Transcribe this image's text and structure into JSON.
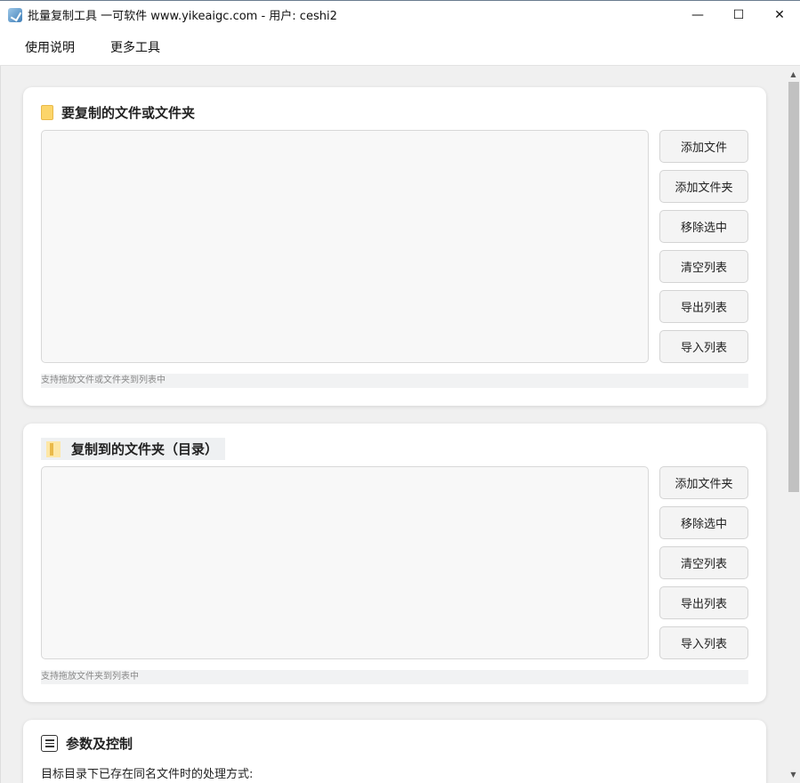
{
  "window": {
    "title": "批量复制工具 一可软件 www.yikeaigc.com - 用户: ceshi2",
    "controls": {
      "minimize": "—",
      "maximize": "☐",
      "close": "✕"
    }
  },
  "menu": {
    "items": [
      "使用说明",
      "更多工具"
    ]
  },
  "source_panel": {
    "title": "要复制的文件或文件夹",
    "buttons": [
      "添加文件",
      "添加文件夹",
      "移除选中",
      "清空列表",
      "导出列表",
      "导入列表"
    ],
    "hint": "支持拖放文件或文件夹到列表中"
  },
  "dest_panel": {
    "title": "复制到的文件夹（目录）",
    "buttons": [
      "添加文件夹",
      "移除选中",
      "清空列表",
      "导出列表",
      "导入列表"
    ],
    "hint": "支持拖放文件夹到列表中"
  },
  "params_panel": {
    "title": "参数及控制",
    "desc": "目标目录下已存在同名文件时的处理方式:"
  },
  "scrollbar": {
    "up": "▲",
    "down": "▼"
  }
}
